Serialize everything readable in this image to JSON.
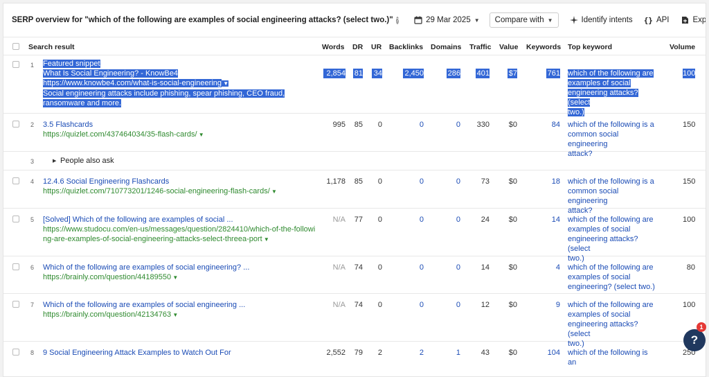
{
  "header": {
    "title": "SERP overview for \"which of the following are examples of social engineering attacks? (select two.)\"",
    "date": "29 Mar 2025",
    "compare_label": "Compare with",
    "identify_label": "Identify intents",
    "api_label": "API",
    "export_label": "Export"
  },
  "columns": {
    "result": "Search result",
    "words": "Words",
    "dr": "DR",
    "ur": "UR",
    "backlinks": "Backlinks",
    "domains": "Domains",
    "traffic": "Traffic",
    "value": "Value",
    "keywords": "Keywords",
    "top_keyword": "Top keyword",
    "volume": "Volume"
  },
  "rows": [
    {
      "pos": "1",
      "label": "Featured snippet",
      "title": "What Is Social Engineering? - KnowBe4",
      "url": "https://www.knowbe4.com/what-is-social-engineering",
      "snippet1": "Social engineering attacks include phishing, spear phishing, CEO fraud,",
      "snippet2": "ransomware and more.",
      "words": "2,854",
      "dr": "81",
      "ur": "34",
      "backlinks": "2,450",
      "domains": "286",
      "traffic": "401",
      "value": "$7",
      "keywords": "761",
      "kw1": "which of the following are",
      "kw2": "examples of social",
      "kw3": "engineering attacks? (select",
      "kw4": "two.)",
      "volume": "100"
    },
    {
      "pos": "2",
      "title": "3.5 Flashcards",
      "url": "https://quizlet.com/437464034/35-flash-cards/",
      "words": "995",
      "dr": "85",
      "ur": "0",
      "backlinks": "0",
      "domains": "0",
      "traffic": "330",
      "value": "$0",
      "keywords": "84",
      "kw1": "which of the following is a",
      "kw2": "common social engineering",
      "kw3": "attack?",
      "volume": "150"
    },
    {
      "pos": "3",
      "title": "People also ask"
    },
    {
      "pos": "4",
      "title": "12.4.6 Social Engineering Flashcards",
      "url": "https://quizlet.com/710773201/1246-social-engineering-flash-cards/",
      "words": "1,178",
      "dr": "85",
      "ur": "0",
      "backlinks": "0",
      "domains": "0",
      "traffic": "73",
      "value": "$0",
      "keywords": "18",
      "kw1": "which of the following is a",
      "kw2": "common social engineering",
      "kw3": "attack?",
      "volume": "150"
    },
    {
      "pos": "5",
      "title": "[Solved] Which of the following are examples of social ...",
      "url1": "https://www.studocu.com/en-us/messages/question/2824410/which-of-the-followi",
      "url2": "ng-are-examples-of-social-engineering-attacks-select-threea-port",
      "words": "N/A",
      "dr": "77",
      "ur": "0",
      "backlinks": "0",
      "domains": "0",
      "traffic": "24",
      "value": "$0",
      "keywords": "14",
      "kw1": "which of the following are",
      "kw2": "examples of social",
      "kw3": "engineering attacks? (select",
      "kw4": "two.)",
      "volume": "100"
    },
    {
      "pos": "6",
      "title": "Which of the following are examples of social engineering? ...",
      "url": "https://brainly.com/question/44189550",
      "words": "N/A",
      "dr": "74",
      "ur": "0",
      "backlinks": "0",
      "domains": "0",
      "traffic": "14",
      "value": "$0",
      "keywords": "4",
      "kw1": "which of the following are",
      "kw2": "examples of social",
      "kw3": "engineering? (select two.)",
      "volume": "80"
    },
    {
      "pos": "7",
      "title": "Which of the following are examples of social engineering ...",
      "url": "https://brainly.com/question/42134763",
      "words": "N/A",
      "dr": "74",
      "ur": "0",
      "backlinks": "0",
      "domains": "0",
      "traffic": "12",
      "value": "$0",
      "keywords": "9",
      "kw1": "which of the following are",
      "kw2": "examples of social",
      "kw3": "engineering attacks? (select",
      "kw4": "two.)",
      "volume": "100"
    },
    {
      "pos": "8",
      "title": "9 Social Engineering Attack Examples to Watch Out For",
      "words": "2,552",
      "dr": "79",
      "ur": "2",
      "backlinks": "2",
      "domains": "1",
      "traffic": "43",
      "value": "$0",
      "keywords": "104",
      "kw1": "which of the following is an",
      "volume": "250"
    }
  ],
  "help_fab": "?",
  "badge": "1",
  "colors": {
    "link": "#1a4bb5",
    "url": "#2f8a2f",
    "selection": "#3367d6"
  }
}
